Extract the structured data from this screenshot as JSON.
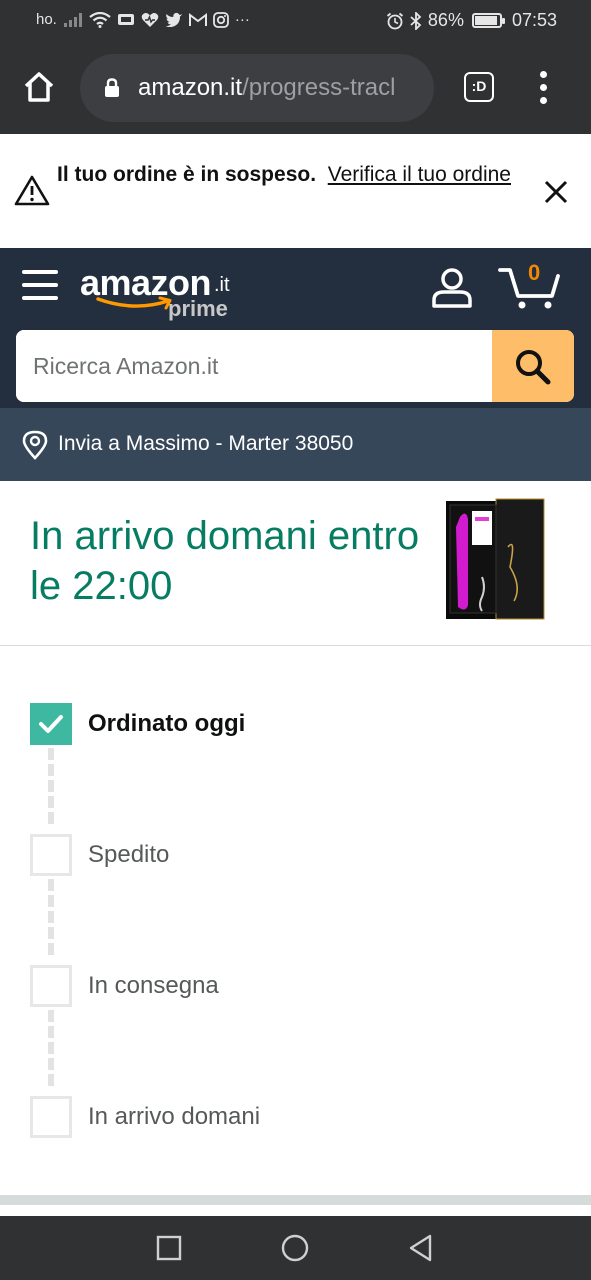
{
  "status_bar": {
    "carrier": "ho.",
    "battery_percent": "86%",
    "battery_level": 0.86,
    "time": "07:53",
    "icons": [
      "signal-icon",
      "wifi-icon",
      "dropbox-icon",
      "health-icon",
      "twitter-icon",
      "gmail-icon",
      "instagram-icon",
      "more-icon",
      "alarm-icon",
      "bluetooth-icon",
      "battery-icon"
    ]
  },
  "browser": {
    "url_domain": "amazon.it",
    "url_path": "/progress-tracl",
    "tabs_label": ":D"
  },
  "alert": {
    "message": "Il tuo ordine è in sospeso.",
    "link": "Verifica il tuo ordine"
  },
  "header": {
    "logo_word": "amazon",
    "logo_tld": ".it",
    "logo_prime": "prime",
    "cart_count": "0",
    "search_placeholder": "Ricerca Amazon.it"
  },
  "deliver": {
    "text": "Invia a Massimo - Marter 38050"
  },
  "shipment": {
    "title": "In arrivo domani entro le 22:00",
    "steps": [
      {
        "label": "Ordinato oggi",
        "done": true
      },
      {
        "label": "Spedito",
        "done": false
      },
      {
        "label": "In consegna",
        "done": false
      },
      {
        "label": "In arrivo domani",
        "done": false
      }
    ]
  },
  "colors": {
    "accent_green": "#067d62",
    "check_teal": "#3fb8a2",
    "amazon_header": "#232f3e",
    "deliver_bar": "#37475a",
    "search_button": "#febd69",
    "cart_orange": "#f08804"
  }
}
